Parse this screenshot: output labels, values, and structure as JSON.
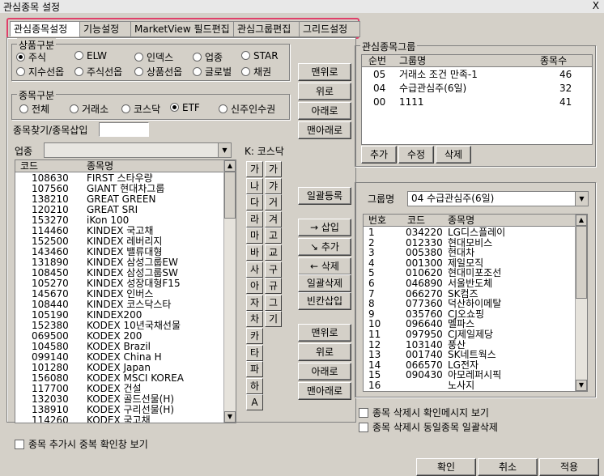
{
  "window": {
    "title": "관심종목 설정",
    "close": "X"
  },
  "tabs": [
    "관심종목설정",
    "기능설정",
    "MarketView 필드편집",
    "관심그룹편집",
    "그리드설정"
  ],
  "product_type": {
    "title": "상품구분",
    "options": [
      "주식",
      "ELW",
      "인덱스",
      "업종",
      "STAR",
      "지수선옵",
      "주식선옵",
      "상품선옵",
      "글로벌",
      "채권"
    ],
    "selected": "주식"
  },
  "stock_type": {
    "title": "종목구분",
    "options": [
      "전체",
      "거래소",
      "코스닥",
      "ETF",
      "신주인수권"
    ],
    "selected": "ETF"
  },
  "search": {
    "label": "종목찾기/종목삽입",
    "value": ""
  },
  "sector": {
    "label": "업종",
    "value": ""
  },
  "k_label": "K: 코스닥",
  "stock_list": {
    "headers": [
      "코드",
      "종목명"
    ],
    "rows": [
      [
        "108630",
        "FIRST 스타우량"
      ],
      [
        "107560",
        "GIANT 현대차그룹"
      ],
      [
        "138210",
        "GREAT GREEN"
      ],
      [
        "120210",
        "GREAT SRI"
      ],
      [
        "153270",
        "iKon 100"
      ],
      [
        "114460",
        "KINDEX 국고채"
      ],
      [
        "152500",
        "KINDEX 레버리지"
      ],
      [
        "143460",
        "KINDEX 밸류대형"
      ],
      [
        "131890",
        "KINDEX 삼성그룹EW"
      ],
      [
        "108450",
        "KINDEX 삼성그룹SW"
      ],
      [
        "105270",
        "KINDEX 성장대형F15"
      ],
      [
        "145670",
        "KINDEX 인버스"
      ],
      [
        "108440",
        "KINDEX 코스닥스타"
      ],
      [
        "105190",
        "KINDEX200"
      ],
      [
        "152380",
        "KODEX 10년국채선물"
      ],
      [
        "069500",
        "KODEX 200"
      ],
      [
        "104580",
        "KODEX Brazil"
      ],
      [
        "099140",
        "KODEX China H"
      ],
      [
        "101280",
        "KODEX Japan"
      ],
      [
        "156080",
        "KODEX MSCI KOREA"
      ],
      [
        "117700",
        "KODEX 건설"
      ],
      [
        "132030",
        "KODEX 골드선물(H)"
      ],
      [
        "138910",
        "KODEX 구리선물(H)"
      ],
      [
        "114260",
        "KODEX 국고채"
      ]
    ]
  },
  "kor_buttons": [
    [
      "가",
      "가"
    ],
    [
      "나",
      "갸"
    ],
    [
      "다",
      "거"
    ],
    [
      "라",
      "겨"
    ],
    [
      "마",
      "고"
    ],
    [
      "바",
      "교"
    ],
    [
      "사",
      "구"
    ],
    [
      "아",
      "규"
    ],
    [
      "자",
      "그"
    ],
    [
      "차",
      "기"
    ],
    [
      "카",
      ""
    ],
    [
      "타",
      ""
    ],
    [
      "파",
      ""
    ],
    [
      "하",
      ""
    ],
    [
      "A",
      ""
    ]
  ],
  "group_buttons": {
    "top": "맨위로",
    "up": "위로",
    "down": "아래로",
    "bottom": "맨아래로"
  },
  "bulk_register": "일괄등록",
  "insert_btn": "→ 삽입",
  "add_btn": "↘ 추가",
  "delete_btn": "← 삭제",
  "delete_all": "일괄삭제",
  "blank_insert": "빈칸삽입",
  "item_buttons": {
    "top": "맨위로",
    "up": "위로",
    "down": "아래로",
    "bottom": "맨아래로"
  },
  "group_panel": {
    "title": "관심종목그룹",
    "headers": [
      "순번",
      "그룹명",
      "종목수"
    ],
    "rows": [
      [
        "05",
        "거래소 조건 만족-1",
        "46"
      ],
      [
        "04",
        "수급관심주(6일)",
        "32"
      ],
      [
        "00",
        "1111",
        "41"
      ]
    ],
    "buttons": [
      "추가",
      "수정",
      "삭제"
    ]
  },
  "group_select": {
    "label": "그룹명",
    "value": "04  수급관심주(6일)"
  },
  "group_items": {
    "headers": [
      "번호",
      "코드",
      "종목명"
    ],
    "rows": [
      [
        "1",
        "034220",
        "LG디스플레이"
      ],
      [
        "2",
        "012330",
        "현대모비스"
      ],
      [
        "3",
        "005380",
        "현대차"
      ],
      [
        "4",
        "001300",
        "제일모직"
      ],
      [
        "5",
        "010620",
        "현대미포조선"
      ],
      [
        "6",
        "046890",
        "서울반도체"
      ],
      [
        "7",
        "066270",
        "SK컴즈"
      ],
      [
        "8",
        "077360",
        "덕산하이메탈"
      ],
      [
        "9",
        "035760",
        "CJ오쇼핑"
      ],
      [
        "10",
        "096640",
        "멜파스"
      ],
      [
        "11",
        "097950",
        "CJ제일제당"
      ],
      [
        "12",
        "103140",
        "풍산"
      ],
      [
        "13",
        "001740",
        "SK네트웍스"
      ],
      [
        "14",
        "066570",
        "LG전자"
      ],
      [
        "15",
        "090430",
        "아모레퍼시픽"
      ],
      [
        "16",
        "",
        "노사지"
      ]
    ]
  },
  "checks": {
    "dup_confirm": "종목 추가시 중복 확인창 보기",
    "delete_confirm": "종목 삭제시 확인메시지 보기",
    "delete_same": "종목 삭제시 동일종목 일괄삭제"
  },
  "footer": {
    "ok": "확인",
    "cancel": "취소",
    "apply": "적용"
  }
}
